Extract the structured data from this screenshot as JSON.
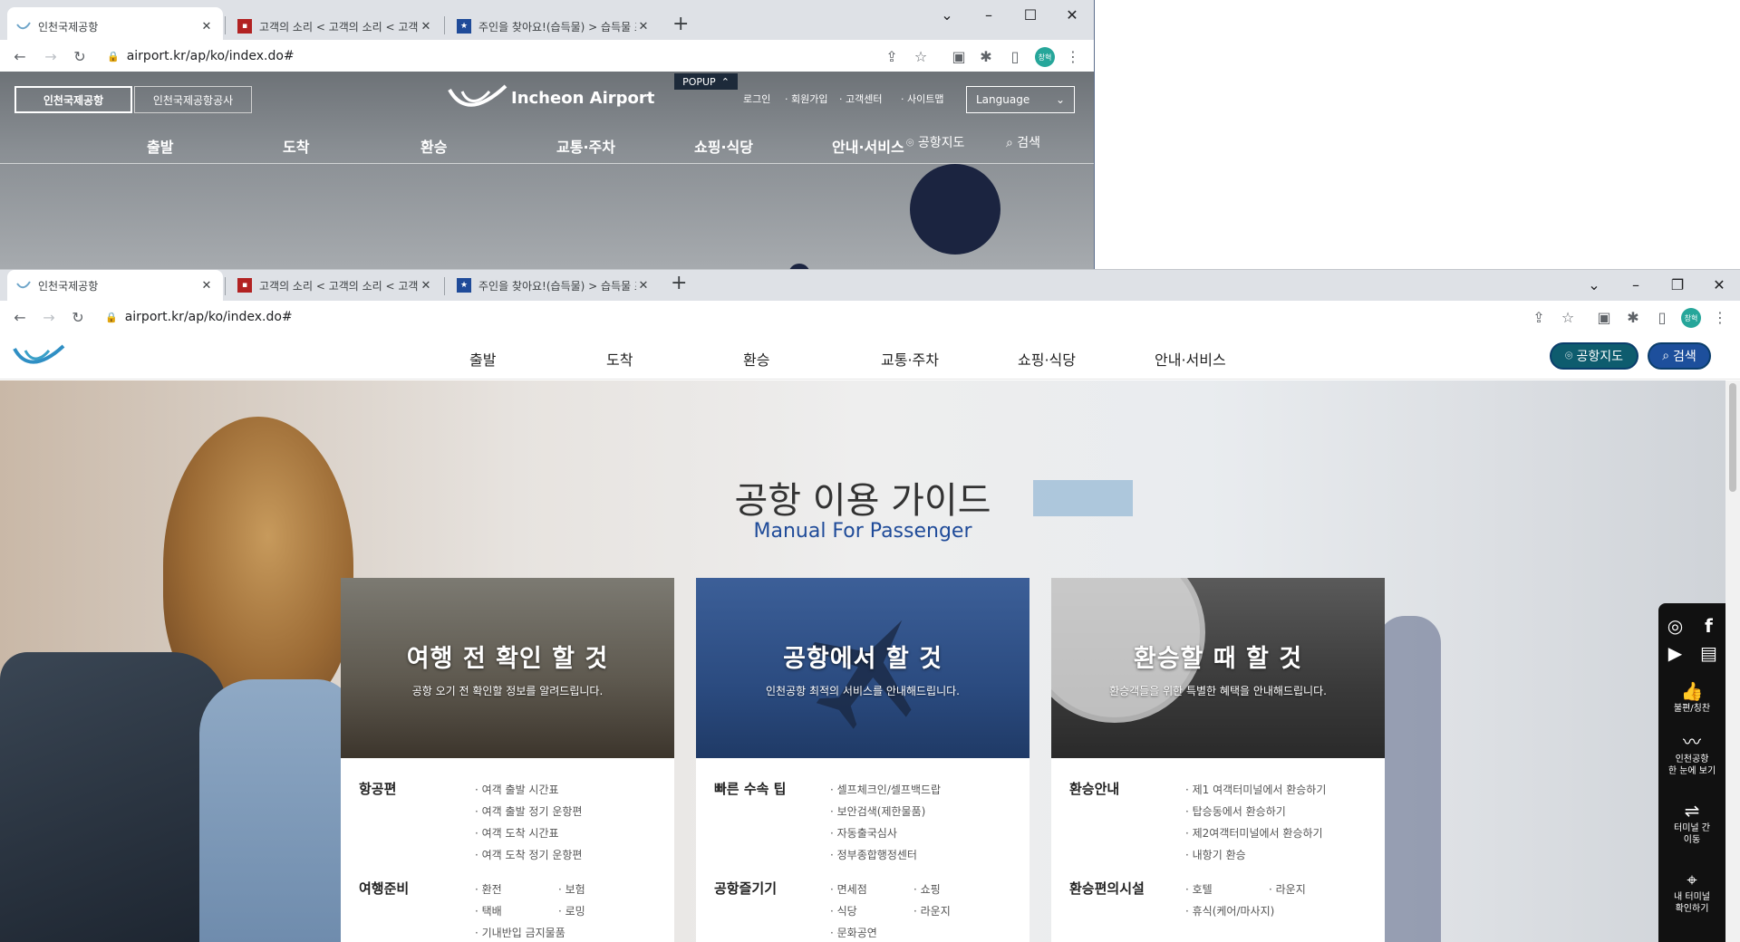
{
  "top_window": {
    "tabs": [
      {
        "title": "인천국제공항"
      },
      {
        "title": "고객의 소리 < 고객의 소리 < 고객참여 | 인천"
      },
      {
        "title": "주인을 찾아요!(습득물) > 습득물 조회 | 인천"
      }
    ],
    "url": "airport.kr/ap/ko/index.do#",
    "profile_label": "창혁",
    "site": {
      "btn_airport": "인천국제공항",
      "btn_corp": "인천국제공항공사",
      "logo_text": "Incheon Airport",
      "popup_label": "POPUP",
      "util_links": [
        "로그인",
        "· 회원가입",
        "· 고객센터",
        "· 사이트맵"
      ],
      "language_label": "Language",
      "nav": [
        "출발",
        "도착",
        "환승",
        "교통·주차",
        "쇼핑·식당",
        "안내·서비스"
      ],
      "map_label": "공항지도",
      "search_label": "검색"
    }
  },
  "main_window": {
    "tabs": [
      {
        "title": "인천국제공항"
      },
      {
        "title": "고객의 소리 < 고객의 소리 < 고객참여 | 인천"
      },
      {
        "title": "주인을 찾아요!(습득물) > 습득물 조회 | 인천"
      }
    ],
    "url": "airport.kr/ap/ko/index.do#",
    "profile_label": "창혁",
    "site": {
      "nav": [
        "출발",
        "도착",
        "환승",
        "교통·주차",
        "쇼핑·식당",
        "안내·서비스"
      ],
      "map_label": "공항지도",
      "search_label": "검색",
      "hero_title": "공항 이용 가이드",
      "hero_subtitle": "Manual For Passenger",
      "cards": [
        {
          "title": "여행 전 확인 할 것",
          "subtitle": "공항 오기 전 확인할 정보를 알려드립니다.",
          "sections": [
            {
              "label": "항공편",
              "links": [
                "· 여객 출발 시간표",
                "· 여객 출발 정기 운항편",
                "· 여객 도착 시간표",
                "· 여객 도착 정기 운항편"
              ]
            },
            {
              "label": "여행준비",
              "links": [
                "· 환전",
                "· 보험",
                "· 택배",
                "· 로밍",
                "· 기내반입 금지물품"
              ]
            }
          ]
        },
        {
          "title": "공항에서 할 것",
          "subtitle": "인천공항 최적의 서비스를 안내해드립니다.",
          "sections": [
            {
              "label": "빠른 수속 팁",
              "links": [
                "· 셀프체크인/셀프백드랍",
                "· 보안검색(제한물품)",
                "· 자동출국심사",
                "· 정부종합행정센터"
              ]
            },
            {
              "label": "공항즐기기",
              "links": [
                "· 면세점",
                "· 쇼핑",
                "· 식당",
                "· 라운지",
                "· 문화공연"
              ]
            }
          ]
        },
        {
          "title": "환승할 때 할 것",
          "subtitle": "환승객들을 위한 특별한 혜택을 안내해드립니다.",
          "sections": [
            {
              "label": "환승안내",
              "links": [
                "· 제1 여객터미널에서 환승하기",
                "· 탑승동에서 환승하기",
                "· 제2여객터미널에서 환승하기",
                "· 내항기 환승"
              ]
            },
            {
              "label": "환승편의시설",
              "links": [
                "· 호텔",
                "· 라운지",
                "· 휴식(케어/마사지)"
              ]
            }
          ]
        }
      ],
      "sidebar": {
        "complaint_label": "불편/칭찬",
        "overview_label": "인천공항\n한 눈에 보기",
        "terminal_move_label": "터미널 간\n이동",
        "my_terminal_label": "내 터미널\n확인하기"
      }
    }
  },
  "colors": {
    "chrome_bg": "#dee1e6",
    "accent_orange": "#f39c4a",
    "brand_navy": "#0a3d6b",
    "hero_title": "#333333",
    "hero_subtitle": "#1f4b99"
  }
}
